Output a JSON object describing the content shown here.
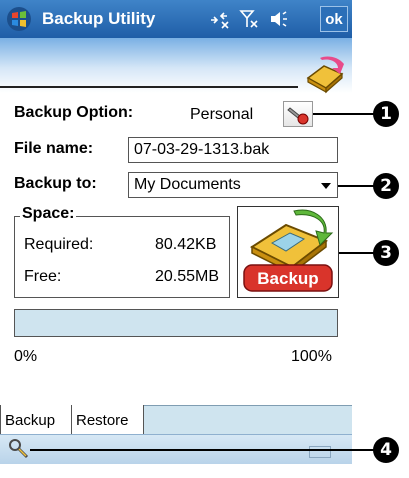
{
  "titlebar": {
    "title": "Backup Utility",
    "ok_label": "ok",
    "icons": [
      "windows-flag-icon",
      "connectivity-icon",
      "signal-icon",
      "volume-icon"
    ]
  },
  "form": {
    "backup_option_label": "Backup Option:",
    "backup_option_value": "Personal",
    "file_name_label": "File name:",
    "file_name_value": "07-03-29-1313.bak",
    "backup_to_label": "Backup to:",
    "backup_to_value": "My Documents"
  },
  "space": {
    "title": "Space:",
    "required_label": "Required:",
    "required_value": "80.42KB",
    "free_label": "Free:",
    "free_value": "20.55MB"
  },
  "backup_button": {
    "label": "Backup"
  },
  "progress": {
    "fraction": 0,
    "start_label": "0%",
    "end_label": "100%"
  },
  "tabs": [
    {
      "label": "Backup",
      "active": true
    },
    {
      "label": "Restore",
      "active": false
    }
  ],
  "callouts": [
    "1",
    "2",
    "3",
    "4"
  ],
  "colors": {
    "accent": "#1f5ea7",
    "progress_bg": "#cfe4ef",
    "backup_red": "#d9342b"
  }
}
